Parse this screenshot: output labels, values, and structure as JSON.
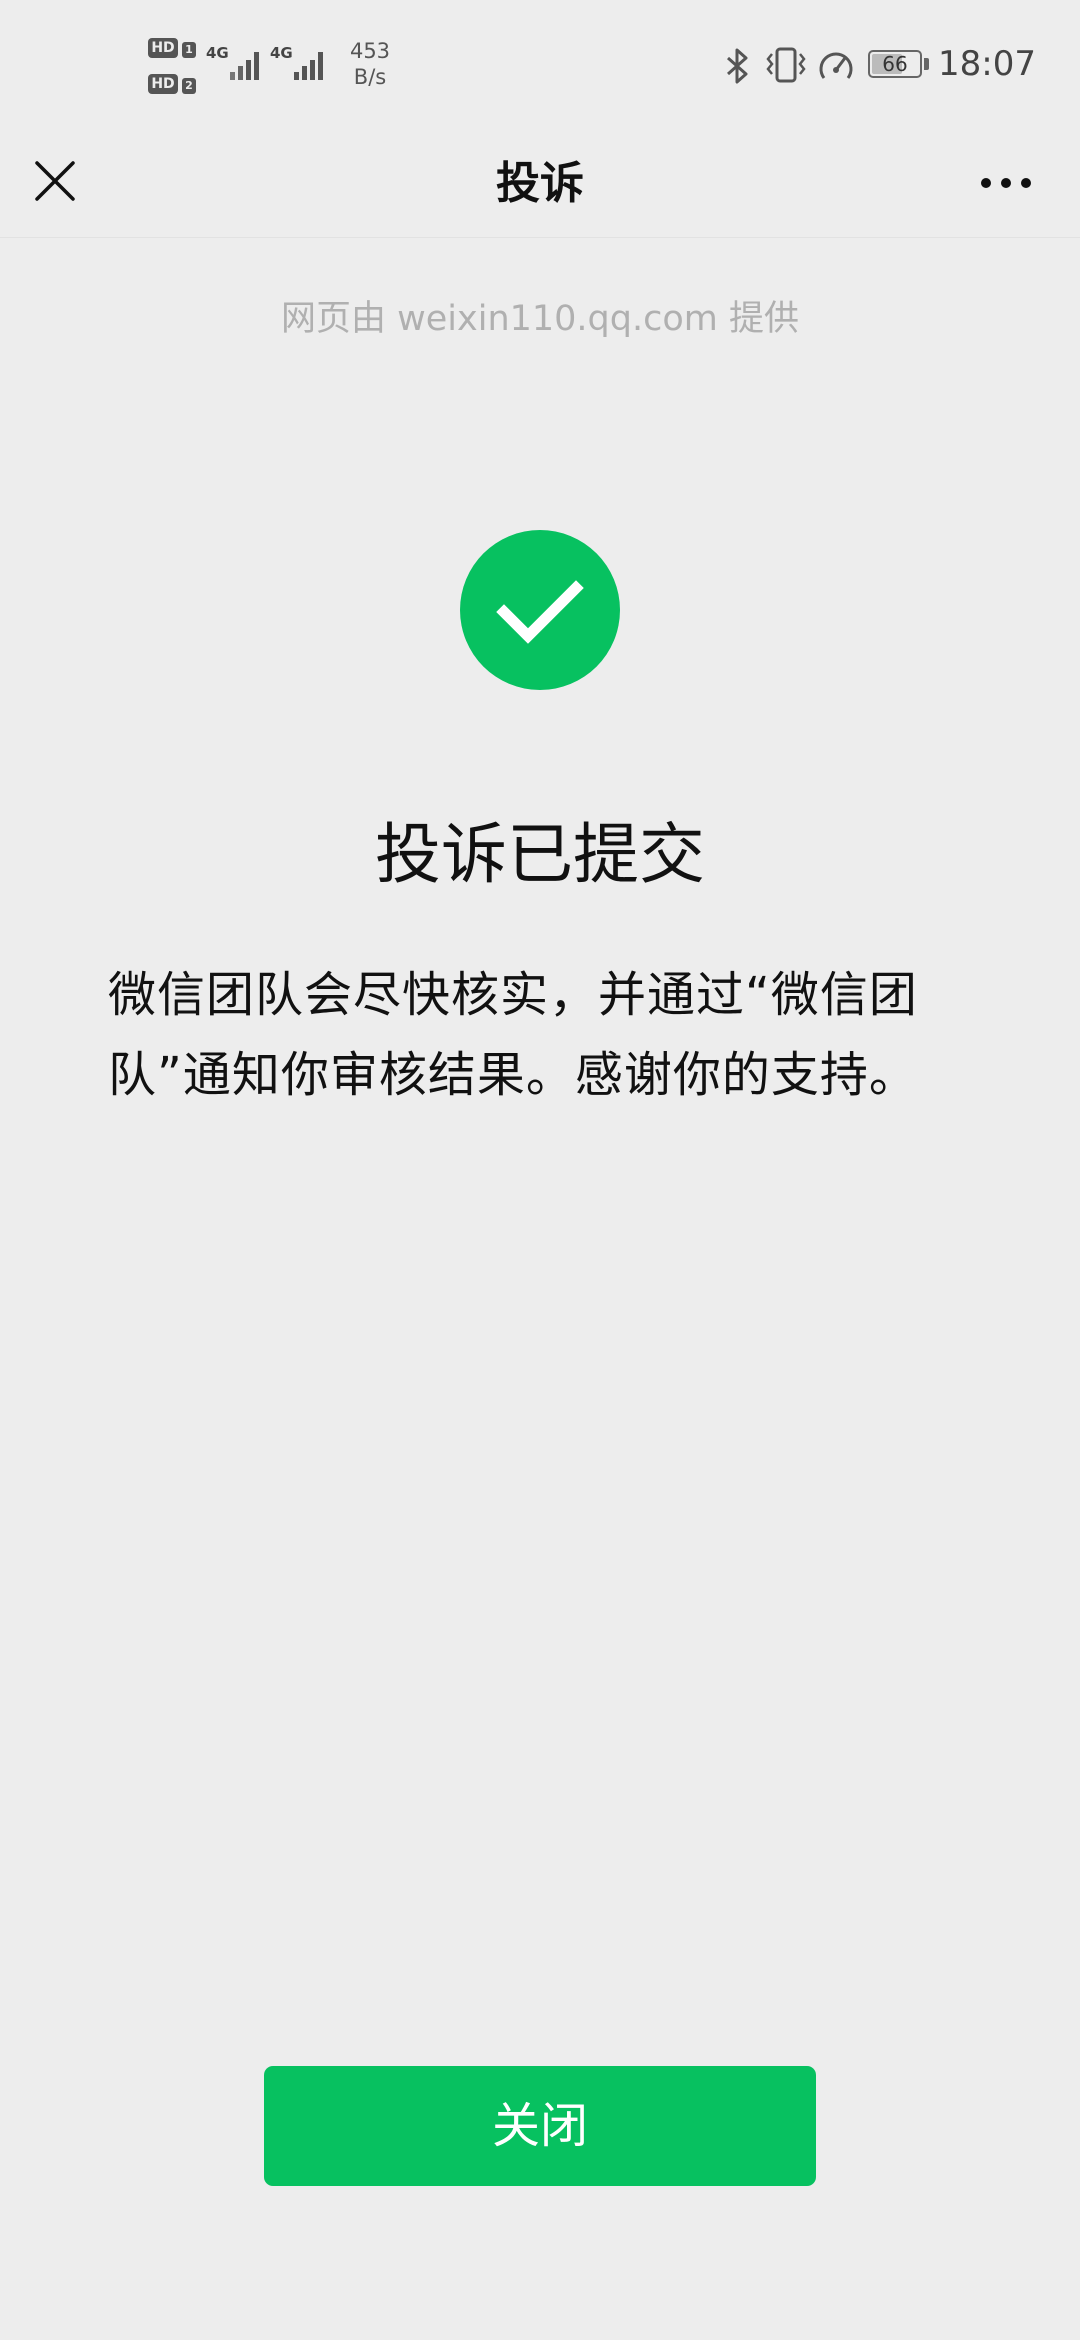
{
  "status_bar": {
    "sim1_label": "HD",
    "sim1_index": "1",
    "sim2_label": "HD",
    "sim2_index": "2",
    "network_a": "4G",
    "network_b": "4G",
    "speed_value": "453",
    "speed_unit": "B/s",
    "battery_level": "66",
    "time": "18:07",
    "icons": [
      "bluetooth-icon",
      "vibrate-icon",
      "data-saver-icon",
      "battery-icon"
    ]
  },
  "nav": {
    "title": "投诉",
    "close_icon": "close-icon",
    "more_icon": "more-icon"
  },
  "content": {
    "provider_note": "网页由 weixin110.qq.com 提供",
    "success_icon": "checkmark-circle-icon",
    "result_title": "投诉已提交",
    "result_description": "微信团队会尽快核实，并通过“微信团队”通知你审核结果。感谢你的支持。"
  },
  "actions": {
    "close_label": "关闭"
  },
  "colors": {
    "accent": "#07c160",
    "background": "#ededed",
    "text_primary": "#111111",
    "text_muted": "#b0b0b0"
  }
}
